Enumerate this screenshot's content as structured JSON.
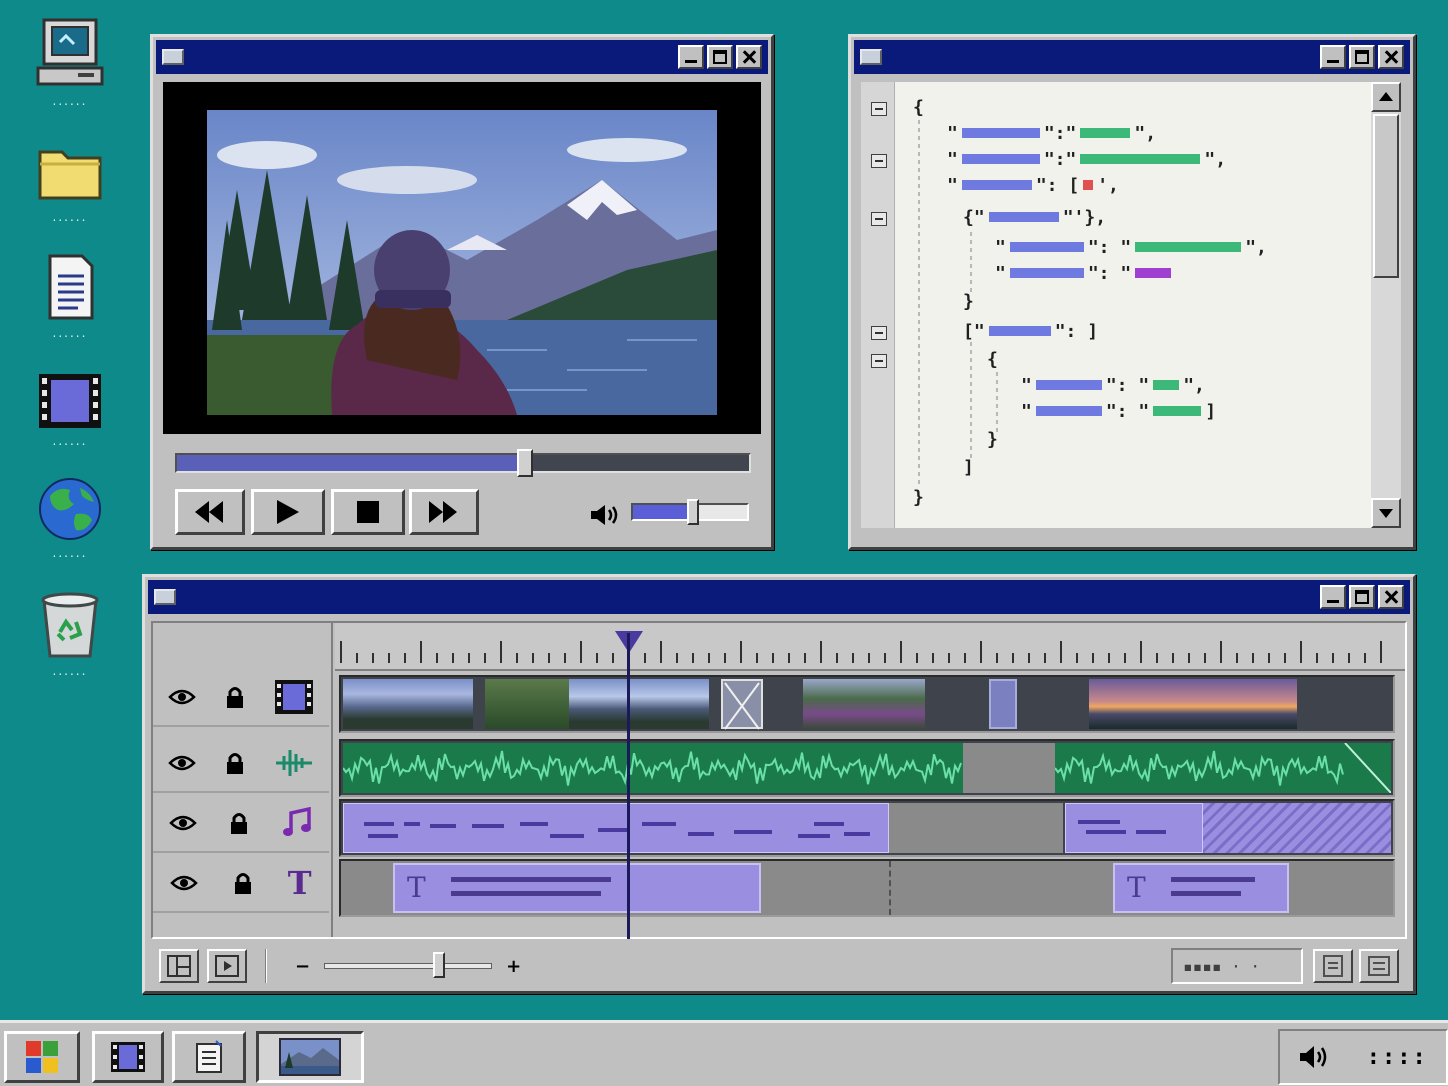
{
  "desktop": {
    "icons": [
      {
        "name": "computer-icon",
        "label": "......"
      },
      {
        "name": "folder-icon",
        "label": "......"
      },
      {
        "name": "document-icon",
        "label": "......"
      },
      {
        "name": "video-file-icon",
        "label": "......"
      },
      {
        "name": "globe-icon",
        "label": "......"
      },
      {
        "name": "recycle-bin-icon",
        "label": "......"
      }
    ]
  },
  "media_player": {
    "seek_progress": 0.6,
    "volume_level": 0.52,
    "controls": [
      "rewind",
      "play",
      "stop",
      "fast-forward"
    ]
  },
  "code_editor": {
    "open_brace": "{",
    "close_brace": "}",
    "colors": {
      "key": "#6e7ae0",
      "string": "#3cb878",
      "number": "#e05050",
      "bool": "#a040d0"
    }
  },
  "timeline": {
    "tracks": [
      "video",
      "audio",
      "music",
      "text"
    ],
    "text_glyph": "T",
    "zoom_minus": "−",
    "zoom_plus": "+",
    "zoom_level": 0.68,
    "timecode_display": "▪▪▪▪  · ·"
  },
  "taskbar": {
    "tray_clock": "::::"
  },
  "colors": {
    "desktop": "#0f8a8a",
    "titlebar": "#0a1a7a",
    "clip_purple": "#9a8ee0",
    "clip_green": "#1a7a4a"
  }
}
